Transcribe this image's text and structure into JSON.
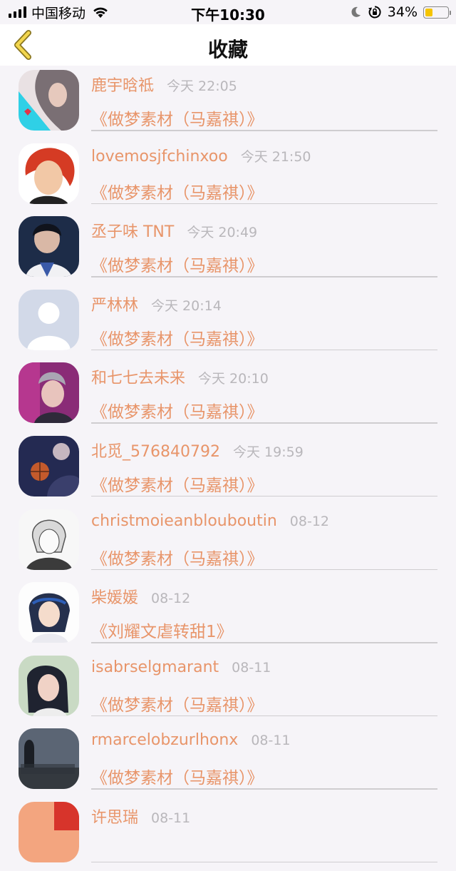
{
  "status_bar": {
    "carrier": "中国移动",
    "time": "下午10:30",
    "battery_percent": "34%",
    "battery_level": 0.34,
    "icons": [
      "signal-icon",
      "wifi-icon",
      "moon-icon",
      "rotation-lock-icon",
      "battery-icon"
    ]
  },
  "nav": {
    "title": "收藏",
    "back_icon": "chevron-left-icon",
    "accent": "#e8c64a"
  },
  "colors": {
    "accent": "#e8956a",
    "meta": "#b9b7bb"
  },
  "favorites": [
    {
      "user": "鹿宇晗祗",
      "time": "今天 22:05",
      "title": "《做梦素材（马嘉祺）》"
    },
    {
      "user": "lovemosjfchinxoo",
      "time": "今天 21:50",
      "title": "《做梦素材（马嘉祺）》"
    },
    {
      "user": "丞子味 TNT",
      "time": "今天 20:49",
      "title": "《做梦素材（马嘉祺）》"
    },
    {
      "user": "严林林",
      "time": "今天 20:14",
      "title": "《做梦素材（马嘉祺）》"
    },
    {
      "user": "和七七去未来",
      "time": "今天 20:10",
      "title": "《做梦素材（马嘉祺）》"
    },
    {
      "user": "北觅_576840792",
      "time": "今天 19:59",
      "title": "《做梦素材（马嘉祺）》"
    },
    {
      "user": "christmoieanblouboutin",
      "time": "08-12",
      "title": "《做梦素材（马嘉祺）》"
    },
    {
      "user": "柴媛媛",
      "time": "08-12",
      "title": "《刘耀文虐转甜1》"
    },
    {
      "user": "isabrselgmarant",
      "time": "08-11",
      "title": "《做梦素材（马嘉祺）》"
    },
    {
      "user": "rmarcelobzurlhonx",
      "time": "08-11",
      "title": "《做梦素材（马嘉祺）》"
    },
    {
      "user": "许思瑞",
      "time": "08-11",
      "title": ""
    }
  ]
}
